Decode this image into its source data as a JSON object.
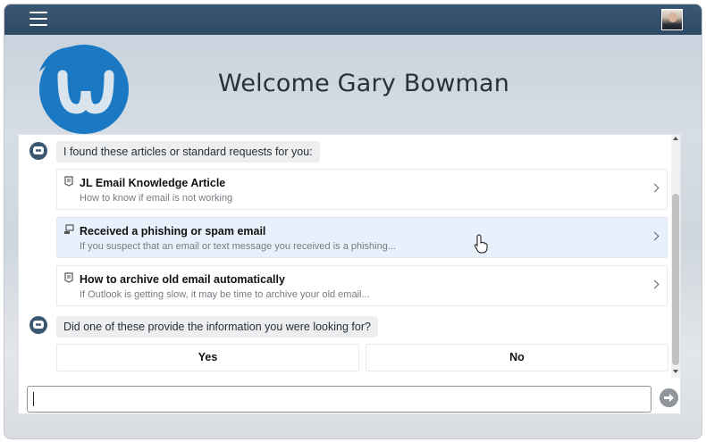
{
  "header": {
    "menu_icon": "hamburger-menu-icon",
    "avatar_icon": "user-avatar"
  },
  "hero": {
    "welcome": "Welcome Gary Bowman",
    "logo_icon": "brand-logo"
  },
  "chat": {
    "intro": "I found these articles or standard requests for you:",
    "results": [
      {
        "icon": "knowledge-article-icon",
        "title": "JL Email Knowledge Article",
        "subtitle": "How to know if email is not working"
      },
      {
        "icon": "request-icon",
        "title": "Received a phishing or spam email",
        "subtitle": "If you suspect that an email or text message you received is a phishing..."
      },
      {
        "icon": "knowledge-article-icon",
        "title": "How to archive old email automatically",
        "subtitle": "If Outlook is getting slow, it may be time to archive your old email..."
      }
    ],
    "question": "Did one of these provide the information you were looking for?",
    "choices": {
      "yes": "Yes",
      "no": "No"
    }
  },
  "composer": {
    "value": "",
    "placeholder": ""
  },
  "colors": {
    "topbar": "#2e4963",
    "brand_blue": "#1a79c2",
    "hover_card": "#e8f1fb"
  }
}
